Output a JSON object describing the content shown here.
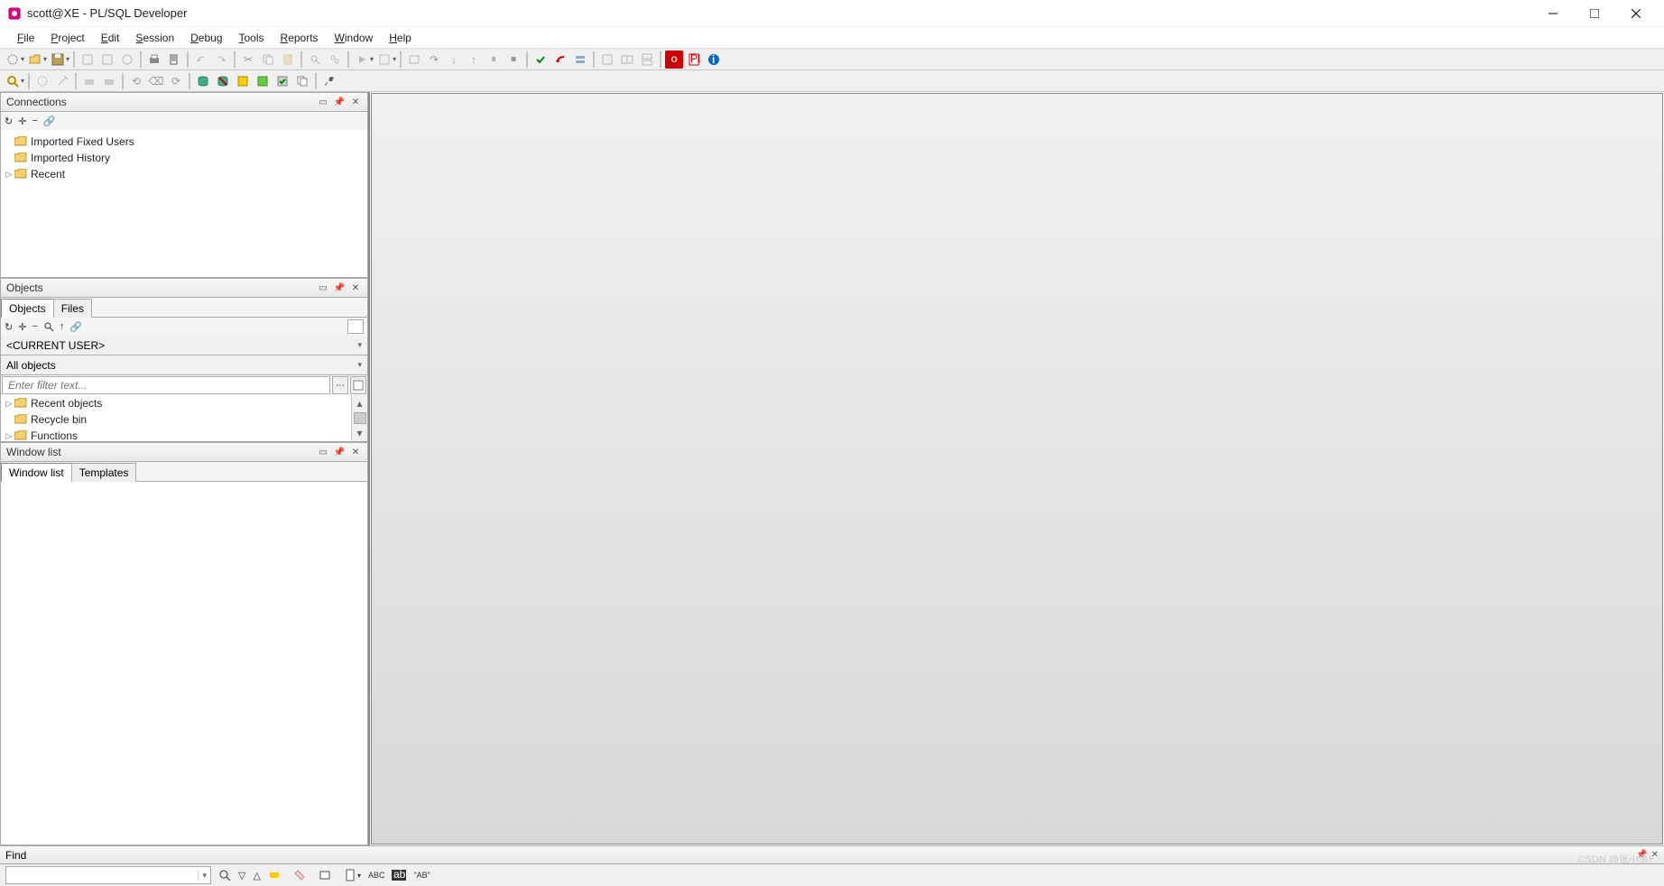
{
  "window": {
    "title": "scott@XE - PL/SQL Developer"
  },
  "menu": {
    "file": "File",
    "project": "Project",
    "edit": "Edit",
    "session": "Session",
    "debug": "Debug",
    "tools": "Tools",
    "reports": "Reports",
    "window": "Window",
    "help": "Help"
  },
  "panels": {
    "connections": {
      "title": "Connections",
      "items": [
        "Imported Fixed Users",
        "Imported History",
        "Recent"
      ]
    },
    "objects": {
      "title": "Objects",
      "tabs": [
        "Objects",
        "Files"
      ],
      "user_combo": "<CURRENT USER>",
      "type_combo": "All objects",
      "filter_placeholder": "Enter filter text...",
      "tree": [
        "Recent objects",
        "Recycle bin",
        "Functions"
      ]
    },
    "windowlist": {
      "title": "Window list",
      "tabs": [
        "Window list",
        "Templates"
      ]
    }
  },
  "find": {
    "title": "Find",
    "abc": "ABC",
    "ab_quoted": "\"AB\""
  },
  "watermark": "CSDN @张小鱼߅"
}
